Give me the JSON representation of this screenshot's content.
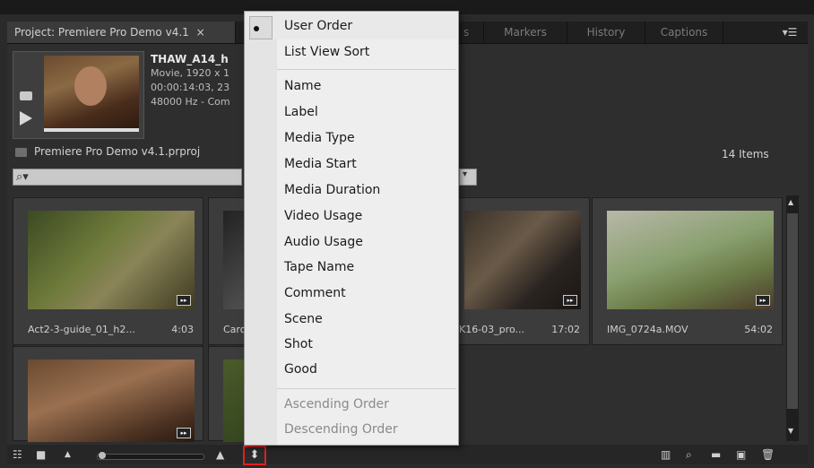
{
  "tabs": {
    "project": "Project: Premiere Pro Demo v4.1",
    "project_close": "×",
    "ghost": "s",
    "markers": "Markers",
    "history": "History",
    "captions": "Captions",
    "panel_menu": "▾☰"
  },
  "clip": {
    "name": "THAW_A14_h",
    "info1": "Movie, 1920 x 1",
    "info2": "00:00:14:03, 23",
    "info3": "48000 Hz - Com"
  },
  "project_path": "Premiere Pro Demo v4.1.prproj",
  "item_count": "14 Items",
  "search": {
    "icon": "⌕▾",
    "dropdown": "▾"
  },
  "tiles": [
    {
      "name": "Act2-3-guide_01_h2...",
      "duration": "4:03"
    },
    {
      "name": "Caro",
      "duration": ""
    },
    {
      "name": "K16-03_pro...",
      "duration": "17:02"
    },
    {
      "name": "IMG_0724a.MOV",
      "duration": "54:02"
    }
  ],
  "badge_glyph": "▸▸",
  "scroll": {
    "up": "▲",
    "down": "▼"
  },
  "bottom": {
    "list_view": "☷",
    "icon_view": "■",
    "zoom_small": "▲",
    "zoom_large": "▲",
    "sort": "⬍",
    "automate": "▥",
    "find": "⌕",
    "new_bin": "▬",
    "new_item": "▣",
    "trash": "🗑"
  },
  "menu": {
    "checked_item": "User Order",
    "items_top": [
      "User Order",
      "List View Sort"
    ],
    "items_mid": [
      "Name",
      "Label",
      "Media Type",
      "Media Start",
      "Media Duration",
      "Video Usage",
      "Audio Usage",
      "Tape Name",
      "Comment",
      "Scene",
      "Shot",
      "Good"
    ],
    "items_bottom_disabled": [
      "Ascending Order",
      "Descending Order"
    ]
  }
}
